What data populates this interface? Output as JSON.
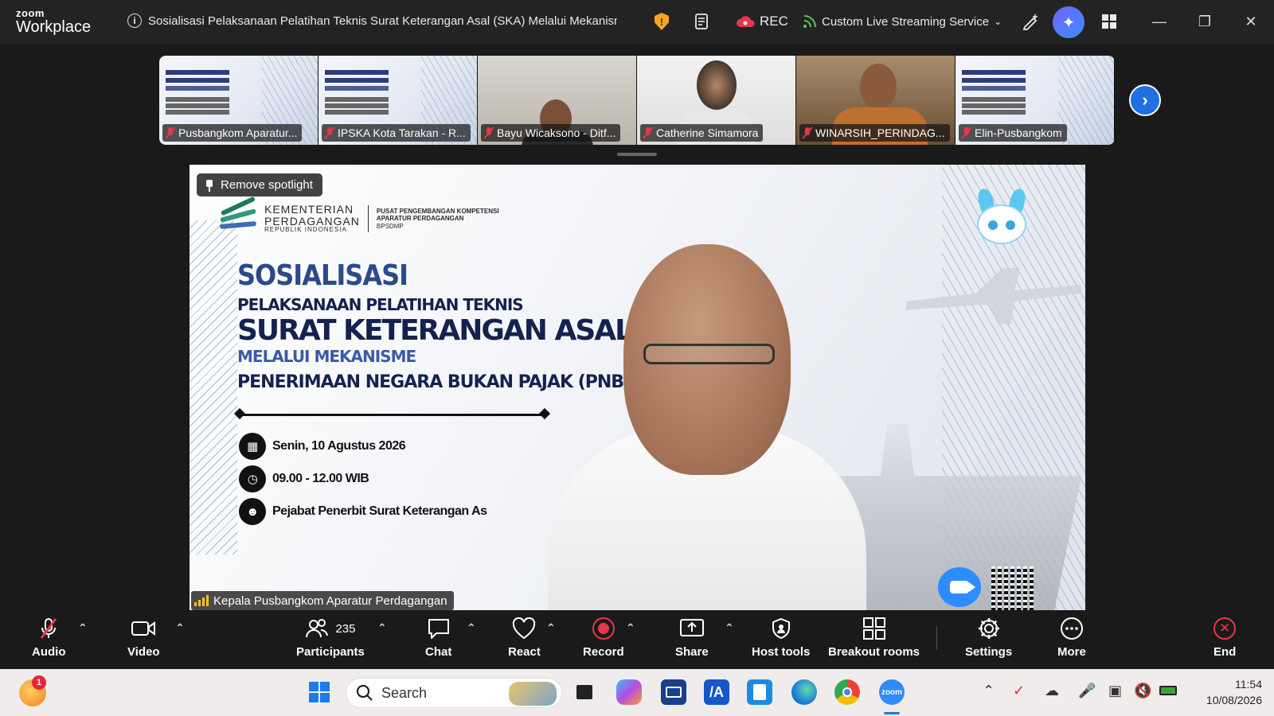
{
  "app": {
    "brand_line1": "zoom",
    "brand_line2": "Workplace"
  },
  "meeting": {
    "title": "Sosialisasi Pelaksanaan Pelatihan Teknis Surat Keterangan Asal (SKA) Melalui Mekanisme Pe",
    "rec_label": "REC",
    "stream_label": "Custom Live Streaming Service"
  },
  "thumbnails": [
    {
      "name": "Pusbangkom Aparatur...",
      "kind": "slide"
    },
    {
      "name": "IPSKA Kota Tarakan - R...",
      "kind": "slide"
    },
    {
      "name": "Bayu Wicaksono - Ditf...",
      "kind": "camera"
    },
    {
      "name": "Catherine Simamora",
      "kind": "camera"
    },
    {
      "name": "WINARSIH_PERINDAG...",
      "kind": "camera"
    },
    {
      "name": "Elin-Pusbangkom",
      "kind": "slide"
    }
  ],
  "spotlight": {
    "remove_label": "Remove spotlight"
  },
  "slide": {
    "org_line1": "KEMENTERIAN",
    "org_line2": "PERDAGANGAN",
    "org_line3": "REPUBLIK INDONESIA",
    "unit_line1": "PUSAT PENGEMBANGAN KOMPETENSI",
    "unit_line2": "APARATUR PERDAGANGAN",
    "unit_line3": "BPSDMP",
    "title": "SOSIALISASI",
    "line2": "PELAKSANAAN PELATIHAN TEKNIS",
    "line3": "SURAT KETERANGAN ASAL (S",
    "line4": "MELALUI MEKANISME",
    "line5": "PENERIMAAN NEGARA BUKAN PAJAK (PNBP)",
    "date": "Senin, 10 Agustus 2026",
    "time": "09.00 - 12.00 WIB",
    "audience": "Pejabat Penerbit Surat Keterangan As"
  },
  "speaker_label": "Kepala Pusbangkom Aparatur Perdagangan",
  "controls": {
    "audio": "Audio",
    "video": "Video",
    "participants": "Participants",
    "participants_count": "235",
    "chat": "Chat",
    "react": "React",
    "record": "Record",
    "share": "Share",
    "host_tools": "Host tools",
    "breakout_rooms": "Breakout rooms",
    "settings": "Settings",
    "more": "More",
    "end": "End"
  },
  "taskbar": {
    "search_placeholder": "Search",
    "notification_count": "1",
    "time": "11:54",
    "date": "10/08/2026"
  },
  "colors": {
    "accent": "#2d8cff",
    "danger": "#e8374a",
    "ai": "#6f63ff"
  }
}
